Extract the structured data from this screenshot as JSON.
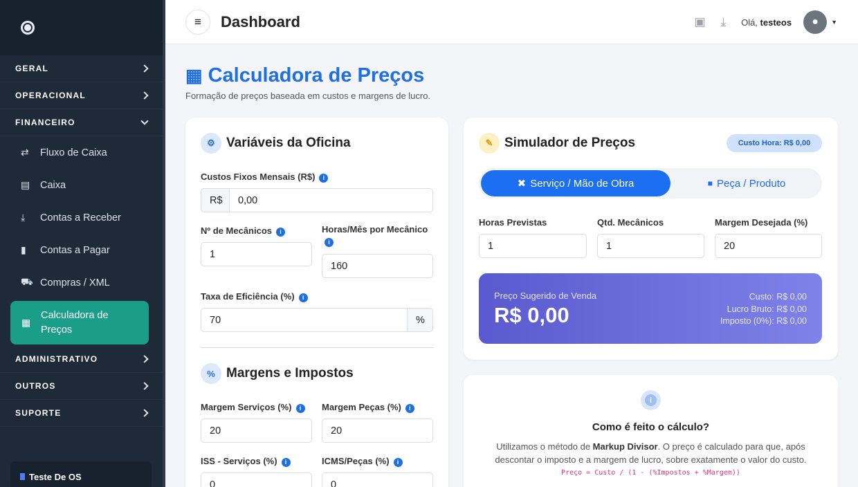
{
  "sidebar": {
    "sections": {
      "geral": "GERAL",
      "operacional": "OPERACIONAL",
      "financeiro": "FINANCEIRO",
      "administrativo": "ADMINISTRATIVO",
      "outros": "OUTROS",
      "suporte": "SUPORTE"
    },
    "items": {
      "fluxo": "Fluxo de Caixa",
      "caixa": "Caixa",
      "receber": "Contas a Receber",
      "pagar": "Contas a Pagar",
      "compras": "Compras / XML",
      "calc_line1": "Calculadora de",
      "calc_line2": "Preços"
    },
    "workspace": "Teste De OS"
  },
  "header": {
    "title": "Dashboard",
    "greeting": "Olá,",
    "user": "testeos"
  },
  "page": {
    "title": "Calculadora de Preços",
    "subtitle": "Formação de preços baseada em custos e margens de lucro."
  },
  "oficina": {
    "title": "Variáveis da Oficina",
    "custos_label": "Custos Fixos Mensais (R$)",
    "custos_prefix": "R$",
    "custos_value": "0,00",
    "mecanicos_label": "Nº de Mecânicos",
    "mecanicos_value": "1",
    "horas_label": "Horas/Mês por Mecânico",
    "horas_value": "160",
    "eficiencia_label": "Taxa de Eficiência (%)",
    "eficiencia_value": "70",
    "eficiencia_suffix": "%"
  },
  "margens": {
    "title": "Margens e Impostos",
    "servicos_label": "Margem Serviços (%)",
    "servicos_value": "20",
    "pecas_label": "Margem Peças (%)",
    "pecas_value": "20",
    "iss_label": "ISS - Serviços (%)",
    "iss_value": "0",
    "icms_label": "ICMS/Peças (%)",
    "icms_value": "0"
  },
  "simulador": {
    "title": "Simulador de Preços",
    "badge": "Custo Hora: R$ 0,00",
    "tab_servico": "Serviço / Mão de Obra",
    "tab_peca": "Peça / Produto",
    "horas_label": "Horas Previstas",
    "horas_value": "1",
    "qtd_label": "Qtd. Mecânicos",
    "qtd_value": "1",
    "margem_label": "Margem Desejada (%)",
    "margem_value": "20",
    "result_label": "Preço Sugerido de Venda",
    "result_value": "R$ 0,00",
    "custo": "Custo: R$ 0,00",
    "lucro": "Lucro Bruto: R$ 0,00",
    "imposto": "Imposto (0%): R$ 0,00"
  },
  "info": {
    "title": "Como é feito o cálculo?",
    "text_before": "Utilizamos o método de",
    "text_bold": "Markup Divisor",
    "text_after": ". O preço é calculado para que, após descontar o imposto e a margem de lucro, sobre exatamente o valor do custo.",
    "formula": "Preço = Custo / (1 - (%Impostos + %Margem))"
  },
  "colors": {
    "accent": "#1f6fe0",
    "sidebar": "#1f2a38",
    "active": "#1a9e8a",
    "result_start": "#5a59cf",
    "result_end": "#7f82e8"
  }
}
